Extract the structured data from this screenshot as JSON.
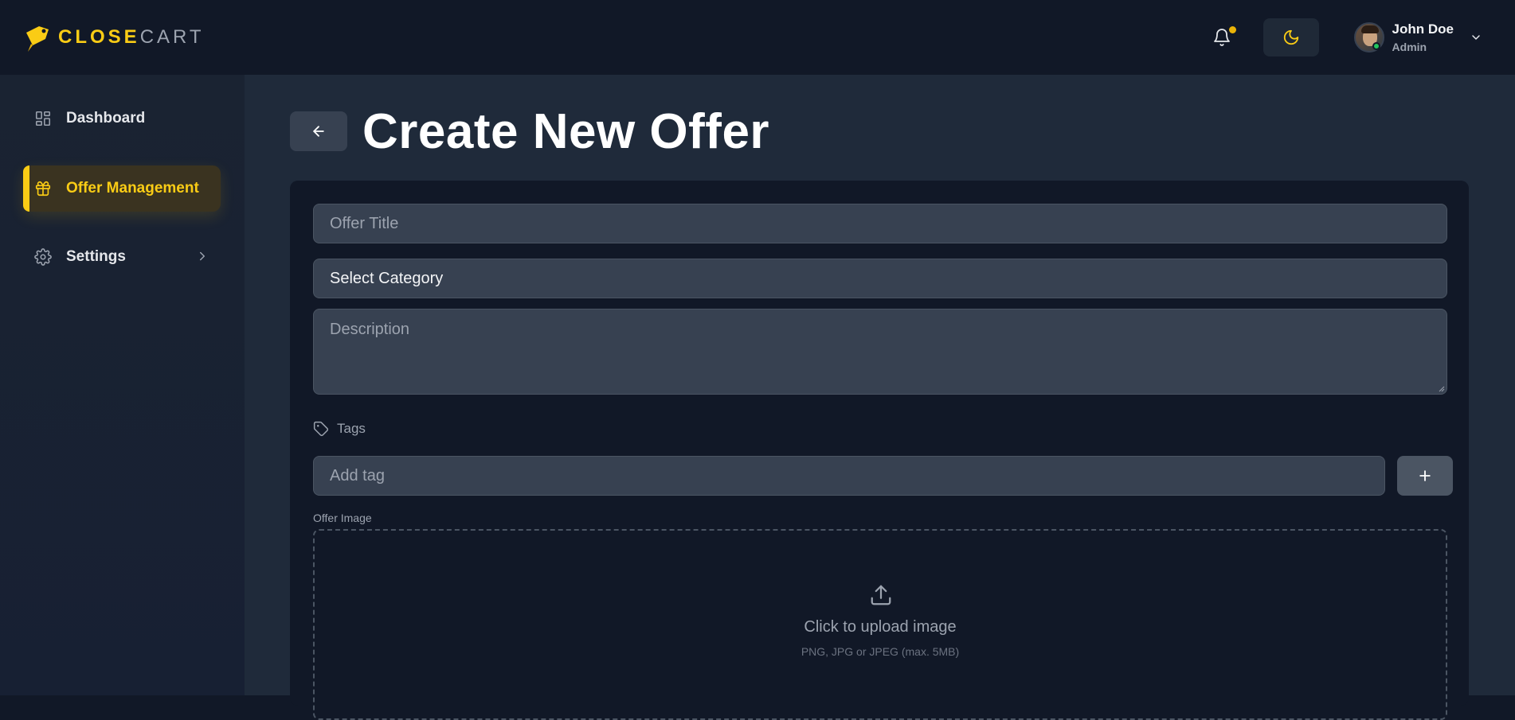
{
  "brand": {
    "part1": "CLOSE",
    "part2": "CART",
    "accent": "#facc15"
  },
  "header": {
    "user": {
      "name": "John Doe",
      "role": "Admin",
      "status": "online"
    }
  },
  "sidebar": {
    "items": [
      {
        "label": "Dashboard",
        "icon": "dashboard-grid-icon",
        "active": false
      },
      {
        "label": "Offer Management",
        "icon": "gift-icon",
        "active": true
      },
      {
        "label": "Settings",
        "icon": "gear-icon",
        "active": false,
        "has_submenu": true
      }
    ]
  },
  "page": {
    "title": "Create New Offer"
  },
  "form": {
    "offer_title_placeholder": "Offer Title",
    "category_value": "Select Category",
    "description_placeholder": "Description",
    "tags_label": "Tags",
    "tag_placeholder": "Add tag",
    "add_tag_label": "+",
    "image_label": "Offer Image",
    "upload_text": "Click to upload image",
    "upload_hint": "PNG, JPG or JPEG (max. 5MB)"
  }
}
